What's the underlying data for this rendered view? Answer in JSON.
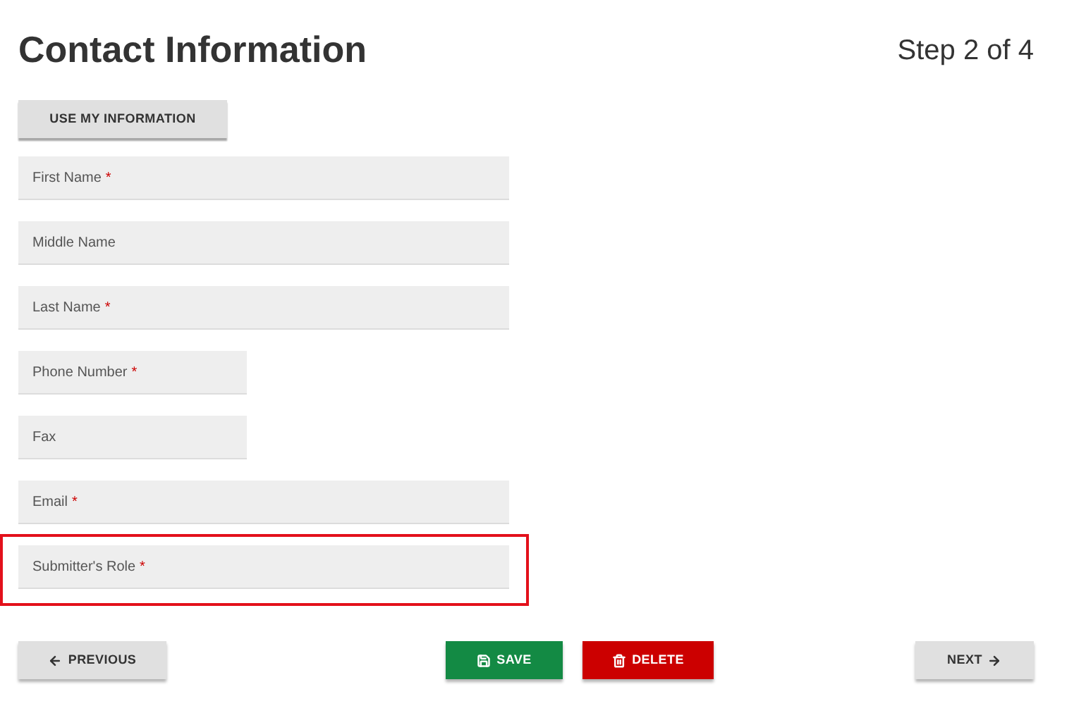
{
  "title": "Contact Information",
  "step": "Step 2 of 4",
  "use_button": "USE MY INFORMATION",
  "fields": [
    {
      "label": "First Name",
      "required_mark": "*",
      "kind": "wide",
      "highlighted": false
    },
    {
      "label": "Middle Name",
      "kind": "wide",
      "highlighted": false
    },
    {
      "label": "Last Name",
      "required_mark": "*",
      "kind": "wide",
      "highlighted": false
    },
    {
      "label": "Phone Number",
      "required_mark": "*",
      "kind": "narrow",
      "highlighted": false
    },
    {
      "label": "Fax",
      "kind": "narrow",
      "highlighted": false
    },
    {
      "label": "Email",
      "required_mark": "*",
      "kind": "wide",
      "highlighted": false
    },
    {
      "label": "Submitter's Role",
      "required_mark": "*",
      "kind": "wide",
      "highlighted": true
    }
  ],
  "buttons": [
    {
      "label": "PREVIOUS",
      "kind": "previous"
    },
    {
      "label": "SAVE",
      "kind": "save"
    },
    {
      "label": "DELETE",
      "kind": "delete"
    },
    {
      "label": "NEXT",
      "kind": "next"
    }
  ]
}
